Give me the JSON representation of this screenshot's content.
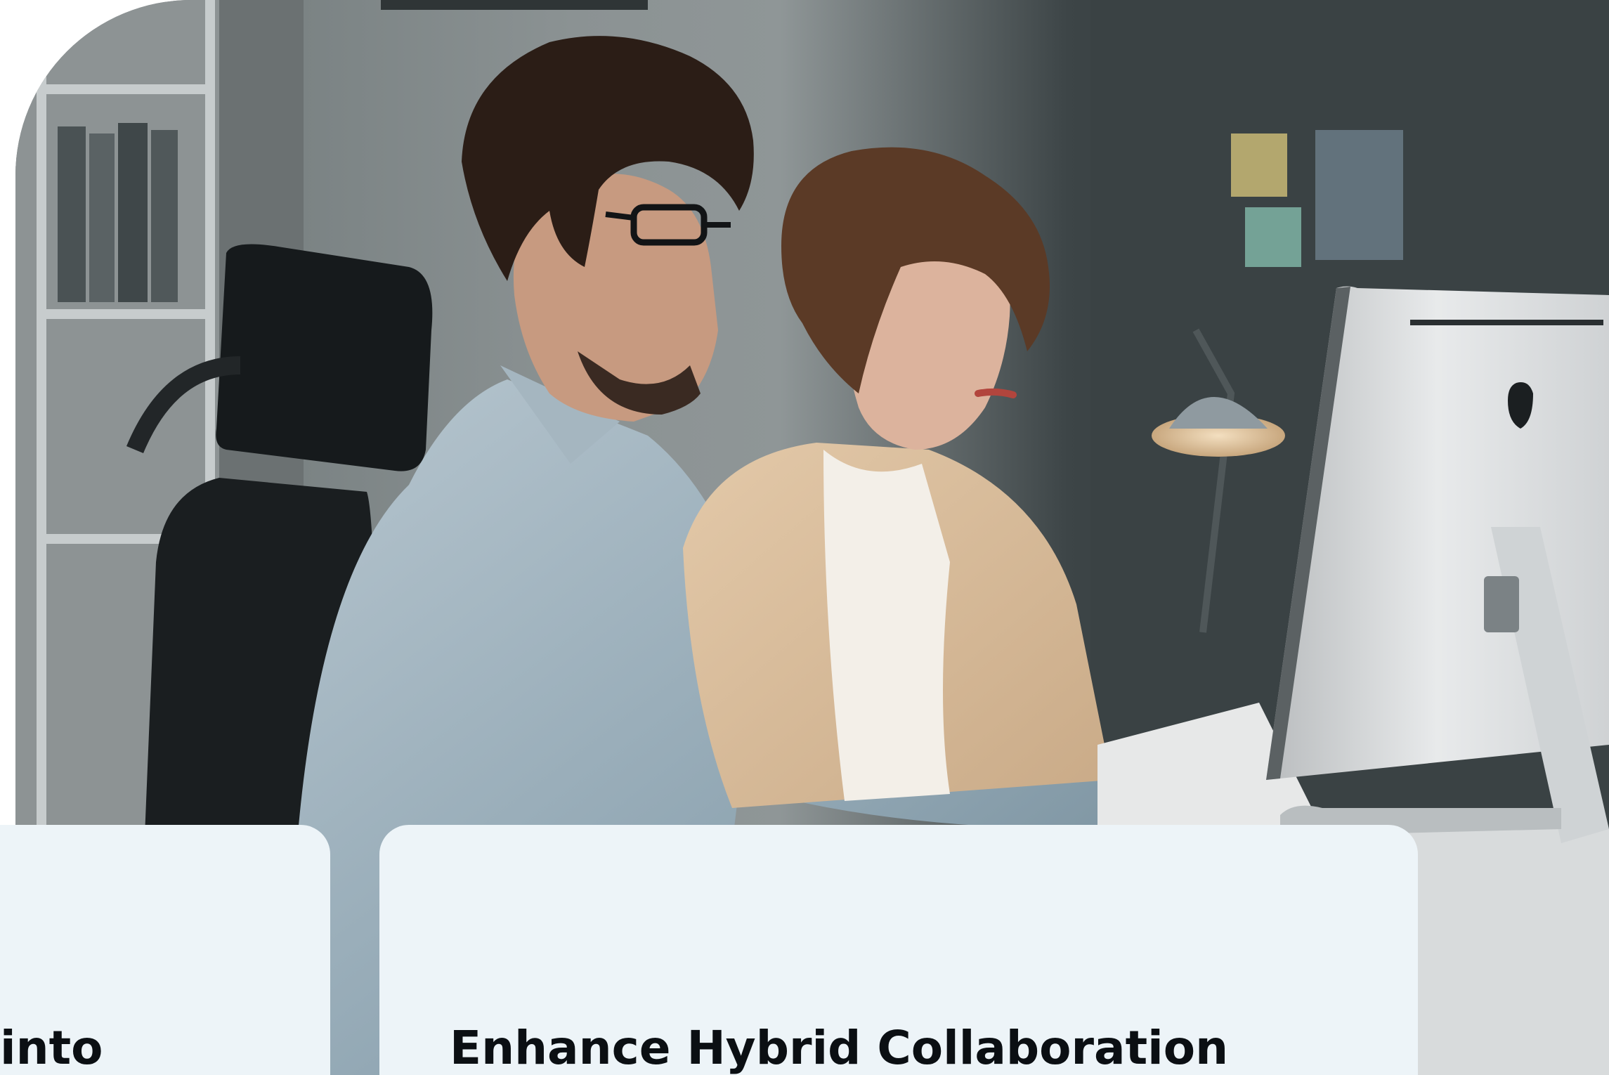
{
  "hero": {
    "image_alt": "Two coworkers looking at a computer monitor in an office",
    "icon": "photo-icon"
  },
  "cards": {
    "left": {
      "title": "into"
    },
    "right": {
      "title": "Enhance Hybrid Collaboration"
    }
  },
  "accent": {
    "colors": [
      "#0a5098",
      "#3ea6df",
      "#e3117f"
    ]
  }
}
